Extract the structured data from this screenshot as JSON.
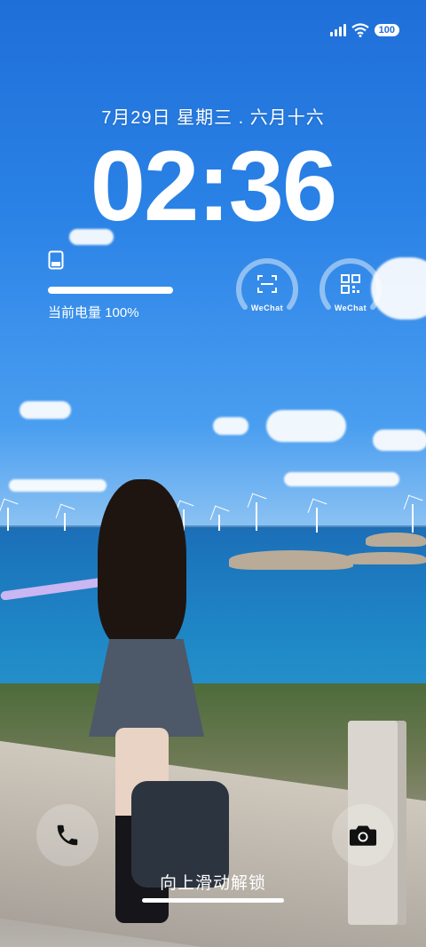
{
  "status_bar": {
    "battery_level": "100",
    "icons": [
      "signal-icon",
      "wifi-icon"
    ]
  },
  "lockscreen": {
    "date": "7月29日 星期三 . 六月十六",
    "time": "02:36",
    "battery_widget": {
      "label": "当前电量 100%",
      "level_percent": 100
    },
    "shortcuts": [
      {
        "label": "WeChat",
        "icon": "scan-icon"
      },
      {
        "label": "WeChat",
        "icon": "qr-code-icon"
      }
    ],
    "bottom": {
      "unlock_hint": "向上滑动解锁",
      "left_icon": "phone-icon",
      "right_icon": "camera-icon"
    }
  },
  "colors": {
    "accent": "#1f6fd8",
    "foreground": "#ffffff"
  }
}
